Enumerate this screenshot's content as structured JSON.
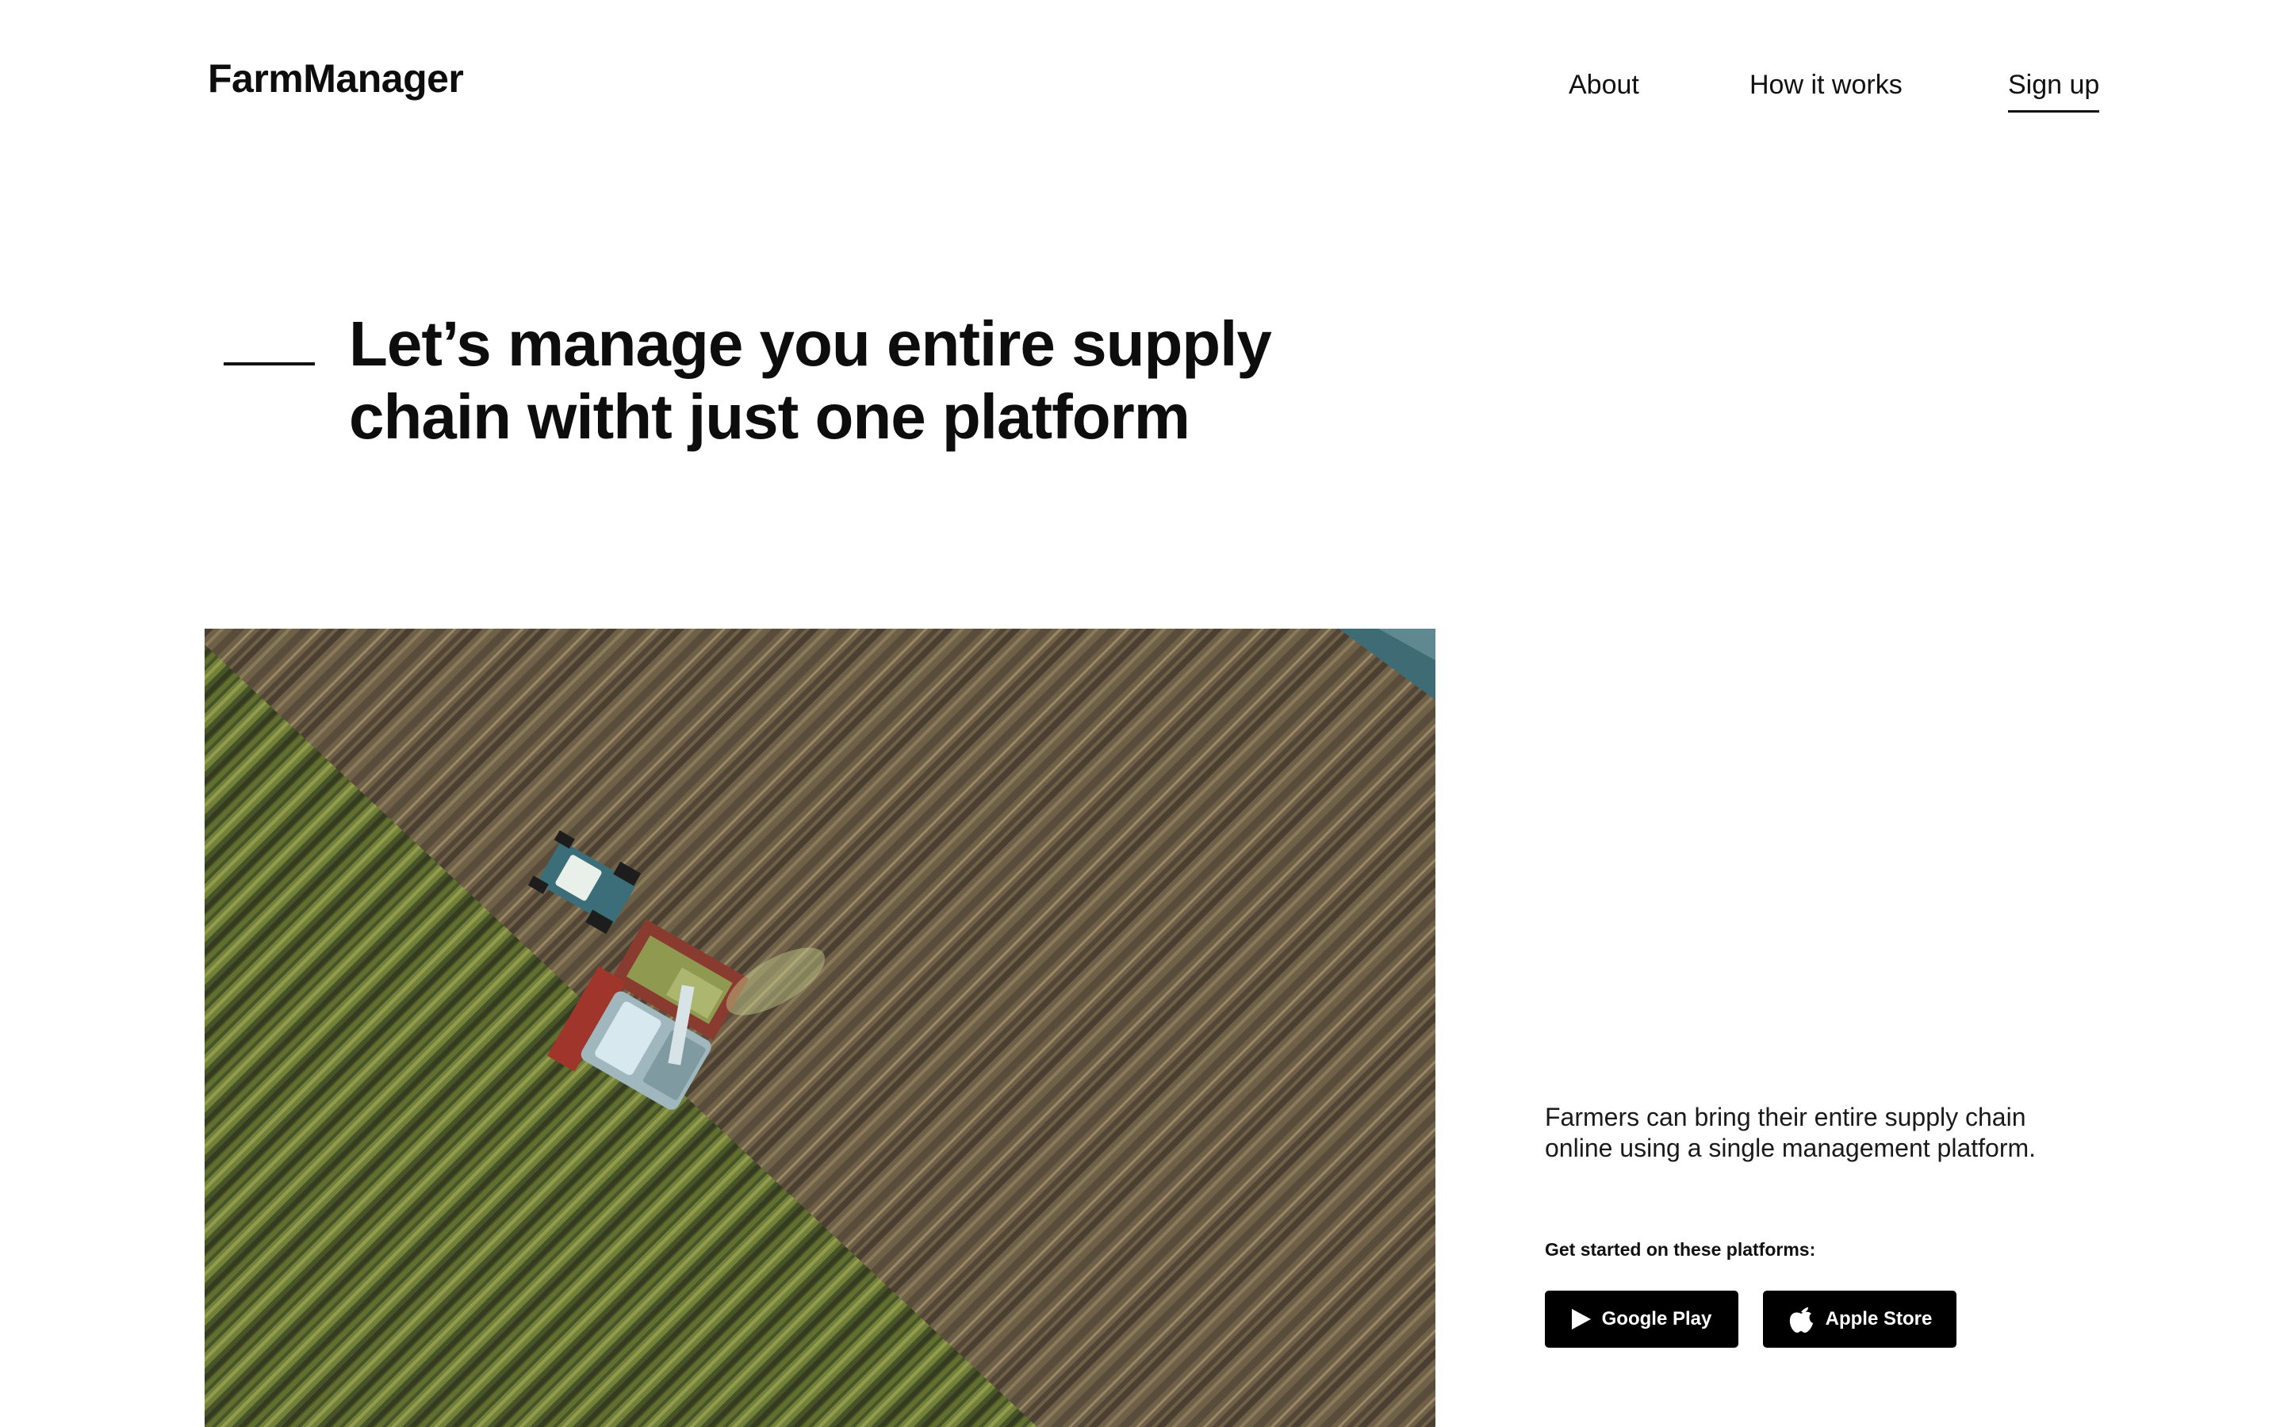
{
  "header": {
    "logo": "FarmManager",
    "nav": [
      {
        "label": "About"
      },
      {
        "label": "How it works"
      },
      {
        "label": "Sign up"
      }
    ]
  },
  "hero": {
    "title_line1": "Let’s manage you entire  supply",
    "title_line2": "chain witht just one platform"
  },
  "field_image": {
    "subject": "aerial view of harvester and tractor in a crop field"
  },
  "aside": {
    "description_line1": "Farmers can bring their entire supply chain",
    "description_line2": "online using a single management platform.",
    "platforms_label": "Get started on these platforms:",
    "buttons": [
      {
        "label": "Google Play",
        "icon": "play-triangle-icon"
      },
      {
        "label": "Apple Store",
        "icon": "apple-icon"
      }
    ]
  },
  "colors": {
    "text": "#0d0d0d",
    "button_bg": "#000000",
    "button_text": "#ffffff",
    "background": "#ffffff"
  }
}
